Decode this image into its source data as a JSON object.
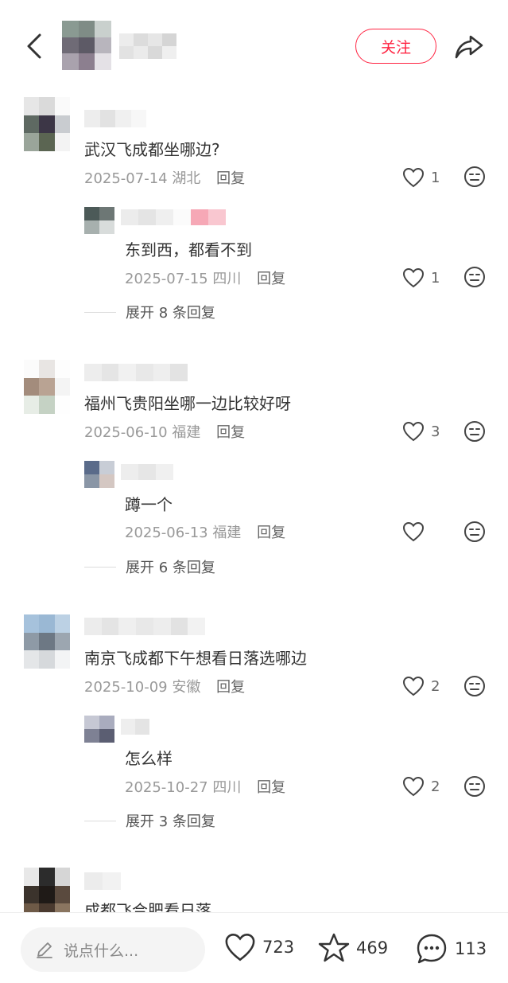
{
  "header": {
    "follow_label": "关注",
    "icons": {
      "back": "chevron-left-icon",
      "share": "share-arrow-icon"
    }
  },
  "comments": [
    {
      "text": "武汉飞成都坐哪边?",
      "date": "2025-07-14",
      "location": "湖北",
      "reply_label": "回复",
      "likes": "1",
      "reply": {
        "text": "东到西，都看不到",
        "date": "2025-07-15",
        "location": "四川",
        "reply_label": "回复",
        "likes": "1"
      },
      "expand_label": "展开 8 条回复"
    },
    {
      "text": "福州飞贵阳坐哪一边比较好呀",
      "date": "2025-06-10",
      "location": "福建",
      "reply_label": "回复",
      "likes": "3",
      "reply": {
        "text": "蹲一个",
        "date": "2025-06-13",
        "location": "福建",
        "reply_label": "回复",
        "likes": ""
      },
      "expand_label": "展开 6 条回复"
    },
    {
      "text": "南京飞成都下午想看日落选哪边",
      "date": "2025-10-09",
      "location": "安徽",
      "reply_label": "回复",
      "likes": "2",
      "reply": {
        "text": "怎么样",
        "date": "2025-10-27",
        "location": "四川",
        "reply_label": "回复",
        "likes": "2"
      },
      "expand_label": "展开 3 条回复"
    },
    {
      "text": "成都飞合肥看日落"
    }
  ],
  "bottom_bar": {
    "input_placeholder": "说点什么...",
    "likes_count": "723",
    "favorites_count": "469",
    "comments_count": "113"
  },
  "colors": {
    "accent": "#ff2442",
    "meta_text": "#999999",
    "body_text": "#333333"
  }
}
